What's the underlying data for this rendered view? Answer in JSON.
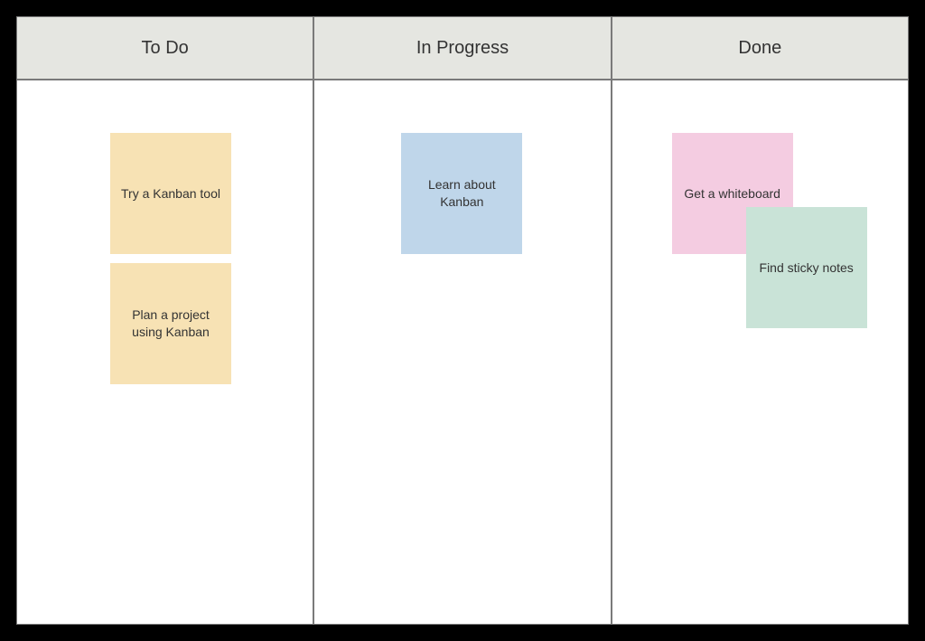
{
  "columns": {
    "todo": {
      "title": "To Do"
    },
    "in_progress": {
      "title": "In Progress"
    },
    "done": {
      "title": "Done"
    }
  },
  "cards": {
    "todo1": "Try a Kanban tool",
    "todo2": "Plan a project using Kanban",
    "prog1": "Learn about Kanban",
    "done1": "Get a whiteboard",
    "done2": "Find sticky notes"
  }
}
